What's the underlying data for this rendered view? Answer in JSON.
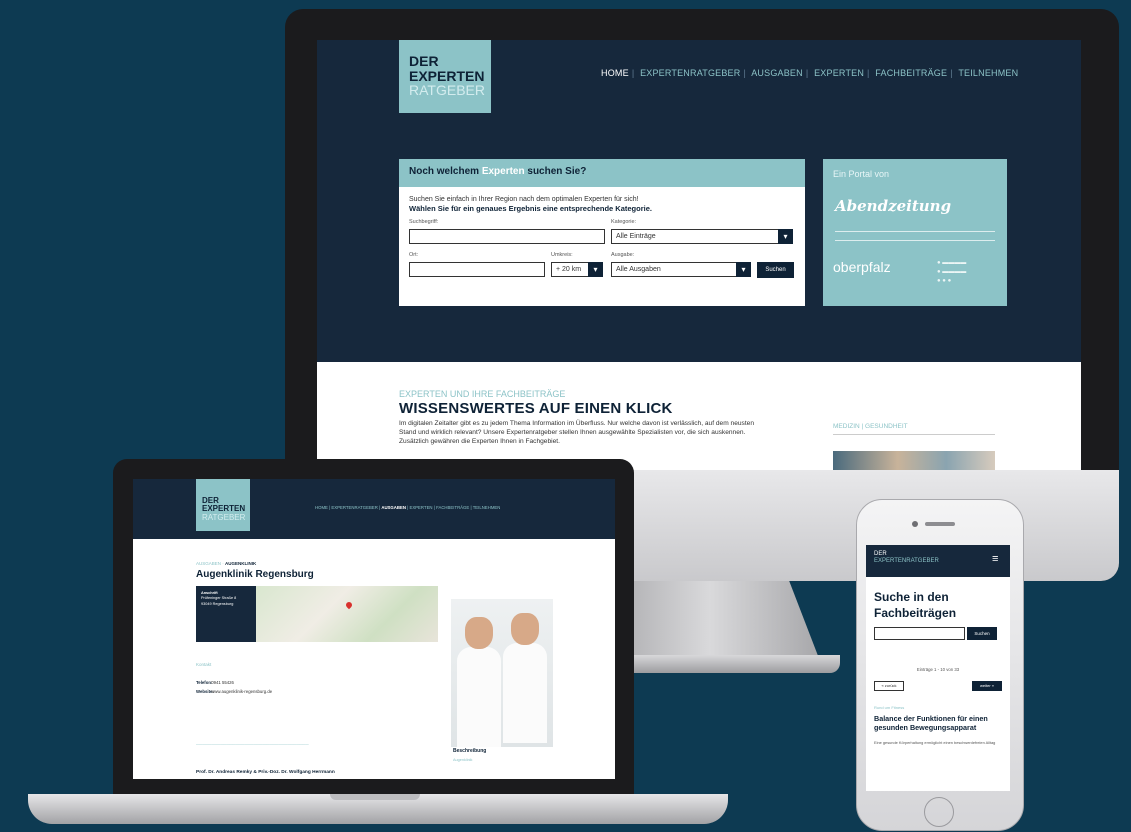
{
  "desktop": {
    "logo": {
      "line1": "DER",
      "line2": "EXPERTEN",
      "line3": "RATGEBER"
    },
    "nav": [
      "HOME",
      "EXPERTENRATGEBER",
      "AUSGABEN",
      "EXPERTEN",
      "FACHBEITRÄGE",
      "TEILNEHMEN"
    ],
    "search": {
      "heading_pre": "Noch welchem",
      "heading_hl": "Experten",
      "heading_post": "suchen Sie?",
      "intro": "Suchen Sie einfach in Ihrer Region nach dem optimalen Experten für sich!",
      "intro_bold": "Wählen Sie für ein genaues Ergebnis eine entsprechende Kategorie.",
      "label_suchbegriff": "Suchbegriff:",
      "label_kategorie": "Kategorie:",
      "kategorie_value": "Alle Einträge",
      "label_ort": "Ort:",
      "label_umkreis": "Umkreis:",
      "umkreis_value": "+ 20 km",
      "label_ausgabe": "Ausgabe:",
      "ausgabe_value": "Alle Ausgaben",
      "submit": "Suchen"
    },
    "portal": {
      "title": "Ein Portal von",
      "brand1": "Abendzeitung",
      "brand2": "oberpfalz"
    },
    "section": {
      "eyebrow": "EXPERTEN UND IHRE FACHBEITRÄGE",
      "title": "WISSENSWERTES AUF EINEN KLICK",
      "text": "Im digitalen Zeitalter gibt es zu jedem Thema Information im Überfluss. Nur welche davon ist verlässlich, auf dem neusten Stand und wirklich relevant? Unsere Expertenratgeber stellen Ihnen ausgewählte Spezialisten vor, die sich auskennen. Zusätzlich gewähren die Experten Ihnen in Fachgebiet.",
      "side_title": "MEDIZIN | GESUNDHEIT"
    }
  },
  "laptop": {
    "logo": {
      "line1": "DER",
      "line2": "EXPERTEN",
      "line3": "RATGEBER"
    },
    "nav": [
      "HOME",
      "EXPERTENRATGEBER",
      "AUSGABEN",
      "EXPERTEN",
      "FACHBEITRÄGE",
      "TEILNEHMEN"
    ],
    "breadcrumb_pre": "AUSGABEN",
    "breadcrumb_current": "AUGENKLINIK",
    "title": "Augenklinik Regensburg",
    "address_label": "Anschrift",
    "address_line1": "Prüfeninger Straße 8",
    "address_line2": "93049 Regensburg",
    "kontakt": "Kontakt",
    "telefon_label": "Telefon:",
    "telefon_value": "0941 55426",
    "website_label": "Website:",
    "website_value": "www.augenklinik-regensburg.de",
    "doctors": "Prof. Dr. Andreas Remky & Priv.-Doz. Dr. Wolfgang Herrmann",
    "beschreibung": "Beschreibung",
    "beschreibung_sub": "Augenklinik"
  },
  "phone": {
    "logo_line1": "DER",
    "logo_line2": "EXPERTENRATGEBER",
    "title_line1": "Suche in den",
    "title_line2": "Fachbeiträgen",
    "search_button": "Suchen",
    "count": "Einträge 1 - 10 von 33",
    "prev": "« zurück",
    "next": "weiter »",
    "category": "Rund um Fitness",
    "article_title": "Balance der Funktionen für einen gesunden Bewegungsapparat",
    "article_text": "Eine gesunde Körperhaltung ermöglicht einen beschwerdefreien Alltag"
  },
  "colors": {
    "navy": "#16283c",
    "accent": "#8cc3c7",
    "background": "#0d3a52"
  }
}
